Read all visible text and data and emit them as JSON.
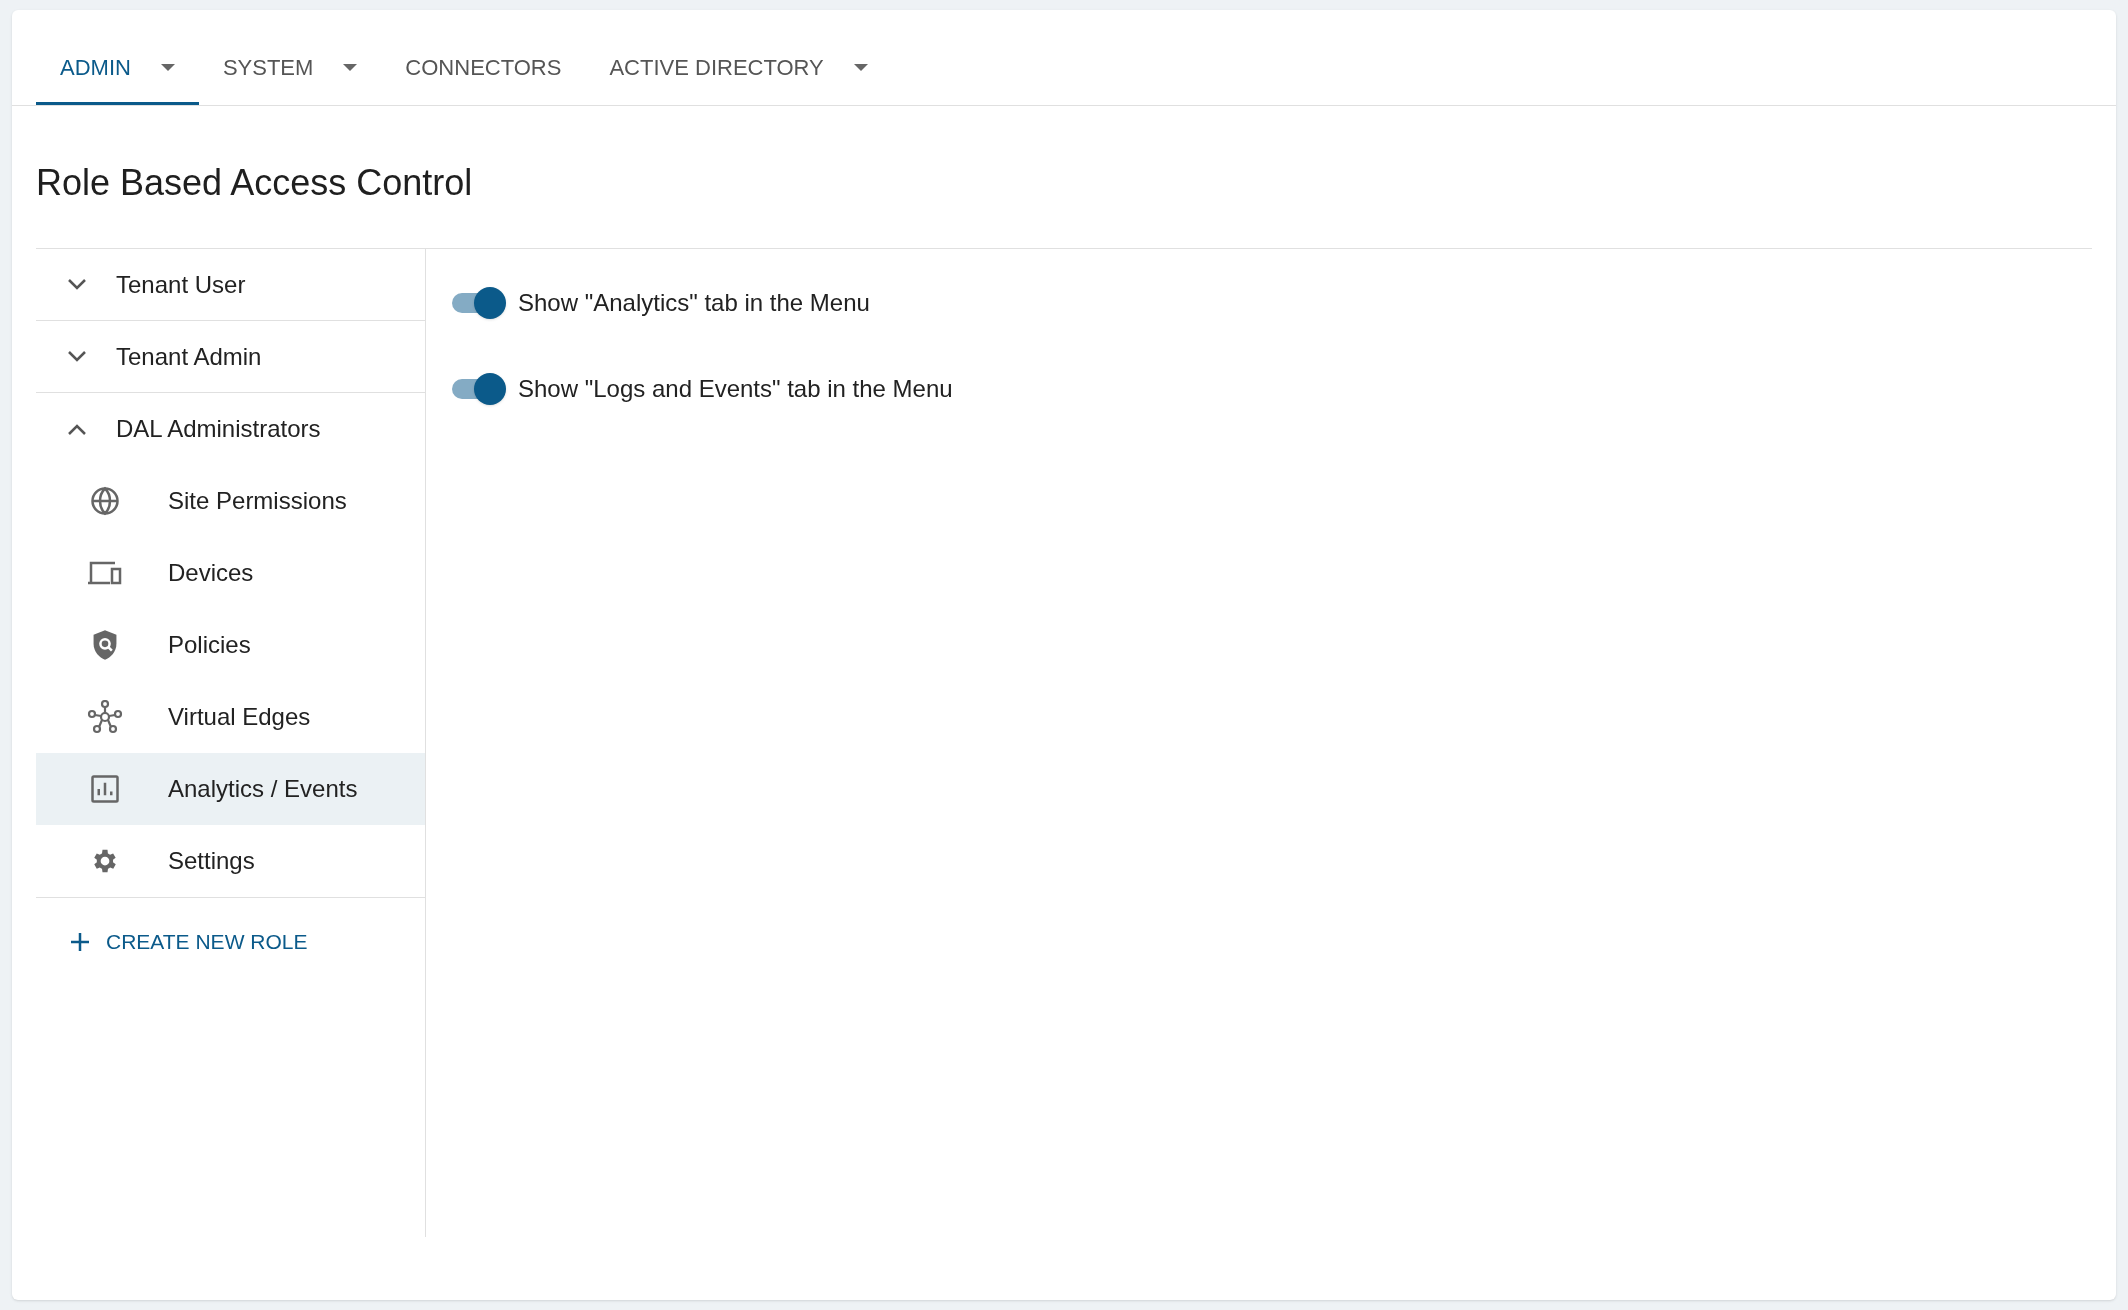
{
  "tabs": [
    {
      "label": "ADMIN",
      "selected": true,
      "dropdown": true
    },
    {
      "label": "SYSTEM",
      "selected": false,
      "dropdown": true
    },
    {
      "label": "CONNECTORS",
      "selected": false,
      "dropdown": false
    },
    {
      "label": "ACTIVE DIRECTORY",
      "selected": false,
      "dropdown": true
    }
  ],
  "title": "Role Based Access Control",
  "roles": [
    {
      "label": "Tenant User",
      "expanded": false
    },
    {
      "label": "Tenant Admin",
      "expanded": false
    },
    {
      "label": "DAL Administrators",
      "expanded": true,
      "children": [
        {
          "label": "Site Permissions",
          "kind": "globe",
          "selected": false
        },
        {
          "label": "Devices",
          "kind": "devices",
          "selected": false
        },
        {
          "label": "Policies",
          "kind": "shield",
          "selected": false
        },
        {
          "label": "Virtual Edges",
          "kind": "network",
          "selected": false
        },
        {
          "label": "Analytics / Events",
          "kind": "chart",
          "selected": true
        },
        {
          "label": "Settings",
          "kind": "gear",
          "selected": false
        }
      ]
    }
  ],
  "create_button": "CREATE NEW ROLE",
  "toggles": [
    {
      "label": "Show \"Analytics\" tab in the Menu",
      "on": true
    },
    {
      "label": "Show \"Logs and Events\" tab in the Menu",
      "on": true
    }
  ]
}
